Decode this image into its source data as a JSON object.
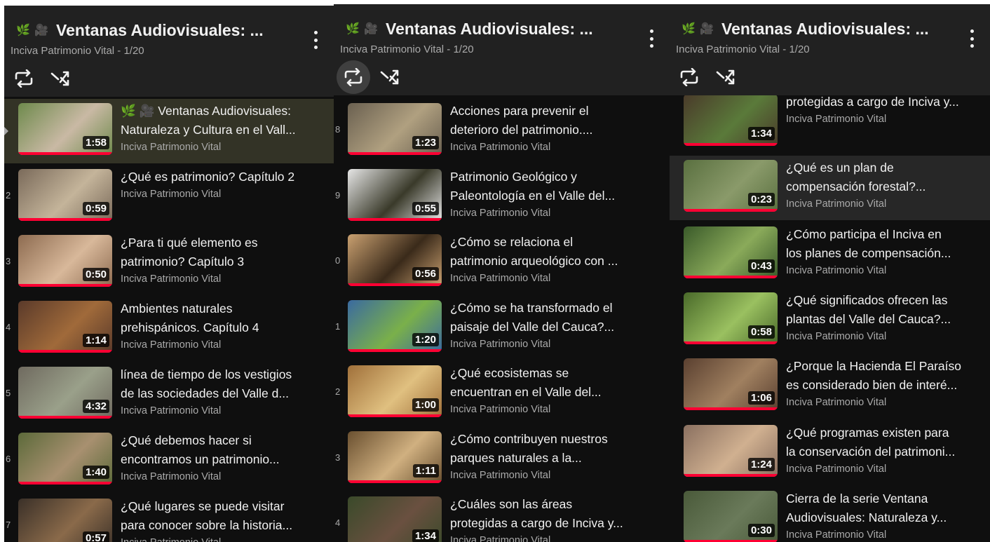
{
  "playlist": {
    "title": "Ventanas Audiovisuales: ...",
    "subtitle": "Inciva Patrimonio Vital - 1/20",
    "emoji_1": "🌿",
    "emoji_2": "🎥",
    "loop_icon": "loop-icon",
    "shuffle_icon": "shuffle-icon",
    "menu_icon": "more-vert-icon",
    "accent_color": "#ff0033"
  },
  "panels": [
    {
      "items": [
        {
          "index": "",
          "title_lines": [
            "🌿 🎥 Ventanas Audiovisuales:",
            "Naturaleza y Cultura en el Vall..."
          ],
          "duration": "1:58",
          "channel": "Inciva Patrimonio Vital",
          "current": true
        },
        {
          "index": "2",
          "title_lines": [
            "¿Qué es patrimonio? Capítulo 2",
            ""
          ],
          "duration": "0:59",
          "channel": "Inciva Patrimonio Vital"
        },
        {
          "index": "3",
          "title_lines": [
            "¿Para ti qué elemento es",
            "patrimonio? Capítulo 3"
          ],
          "duration": "0:50",
          "channel": "Inciva Patrimonio Vital"
        },
        {
          "index": "4",
          "title_lines": [
            "Ambientes naturales",
            "prehispánicos. Capítulo 4"
          ],
          "duration": "1:14",
          "channel": "Inciva Patrimonio Vital"
        },
        {
          "index": "5",
          "title_lines": [
            "línea de tiempo de los vestigios",
            "de las sociedades del Valle d..."
          ],
          "duration": "4:32",
          "channel": "Inciva Patrimonio Vital"
        },
        {
          "index": "6",
          "title_lines": [
            "¿Qué debemos hacer si",
            "encontramos un patrimonio..."
          ],
          "duration": "1:40",
          "channel": "Inciva Patrimonio Vital"
        },
        {
          "index": "7",
          "title_lines": [
            "¿Qué lugares se puede visitar",
            "para conocer sobre la historia..."
          ],
          "duration": "0:57",
          "channel": "Inciva Patrimonio Vital"
        }
      ]
    },
    {
      "items": [
        {
          "index": "8",
          "title_lines": [
            "Acciones para prevenir el",
            "deterioro del patrimonio...."
          ],
          "duration": "1:23",
          "channel": "Inciva Patrimonio Vital"
        },
        {
          "index": "9",
          "title_lines": [
            "Patrimonio Geológico y",
            "Paleontología en el Valle del..."
          ],
          "duration": "0:55",
          "channel": "Inciva Patrimonio Vital"
        },
        {
          "index": "0",
          "title_lines": [
            "¿Cómo se relaciona el",
            "patrimonio arqueológico con ..."
          ],
          "duration": "0:56",
          "channel": "Inciva Patrimonio Vital"
        },
        {
          "index": "1",
          "title_lines": [
            "¿Cómo se ha transformado el",
            "paisaje del Valle del Cauca?..."
          ],
          "duration": "1:20",
          "channel": "Inciva Patrimonio Vital"
        },
        {
          "index": "2",
          "title_lines": [
            "¿Qué ecosistemas se",
            "encuentran en el Valle del..."
          ],
          "duration": "1:00",
          "channel": "Inciva Patrimonio Vital"
        },
        {
          "index": "3",
          "title_lines": [
            "¿Cómo contribuyen nuestros",
            "parques naturales a la..."
          ],
          "duration": "1:11",
          "channel": "Inciva Patrimonio Vital"
        },
        {
          "index": "4",
          "title_lines": [
            "¿Cuáles son las áreas",
            "protegidas a cargo de Inciva y..."
          ],
          "duration": "1:34",
          "channel": "Inciva Patrimonio Vital"
        }
      ]
    },
    {
      "items": [
        {
          "index": "",
          "title_lines": [
            "protegidas a cargo de Inciva y...",
            ""
          ],
          "duration": "1:34",
          "channel": "Inciva Patrimonio Vital"
        },
        {
          "index": "",
          "title_lines": [
            "¿Qué es un plan de",
            "compensación forestal?..."
          ],
          "duration": "0:23",
          "channel": "Inciva Patrimonio Vital",
          "highlight": true
        },
        {
          "index": "",
          "title_lines": [
            "¿Cómo participa el Inciva en",
            "los planes de compensación..."
          ],
          "duration": "0:43",
          "channel": "Inciva Patrimonio Vital"
        },
        {
          "index": "",
          "title_lines": [
            "¿Qué significados ofrecen las",
            "plantas del Valle del Cauca?..."
          ],
          "duration": "0:58",
          "channel": "Inciva Patrimonio Vital"
        },
        {
          "index": "",
          "title_lines": [
            "¿Porque la Hacienda El Paraíso",
            "es considerado bien de interé..."
          ],
          "duration": "1:06",
          "channel": "Inciva Patrimonio Vital"
        },
        {
          "index": "",
          "title_lines": [
            "¿Qué programas existen para",
            "la conservación del patrimoni..."
          ],
          "duration": "1:24",
          "channel": "Inciva Patrimonio Vital"
        },
        {
          "index": "",
          "title_lines": [
            "Cierra de la serie Ventana",
            "Audiovisuales: Naturaleza y..."
          ],
          "duration": "0:30",
          "channel": "Inciva Patrimonio Vital"
        }
      ]
    }
  ]
}
